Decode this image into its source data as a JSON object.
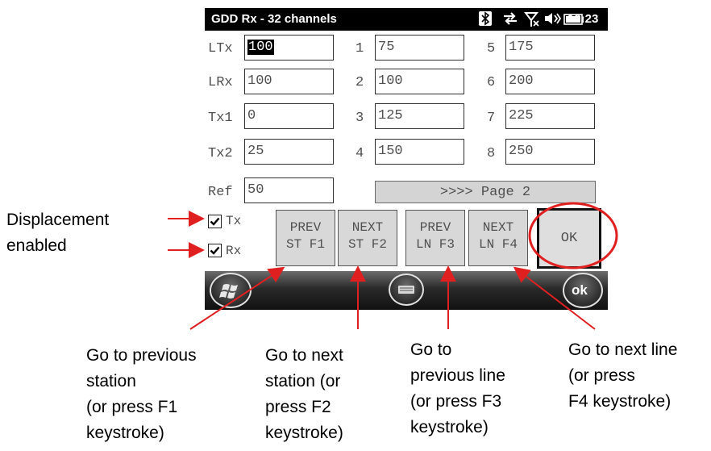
{
  "titlebar": {
    "title": "GDD Rx - 32 channels",
    "time": "10:23",
    "icons": [
      "bluetooth-icon",
      "sync-icon",
      "no-signal-icon",
      "volume-icon",
      "battery-icon"
    ]
  },
  "form": {
    "left_fields": [
      {
        "label": "LTx",
        "value": "100"
      },
      {
        "label": "LRx",
        "value": "100"
      },
      {
        "label": "Tx1",
        "value": "0"
      },
      {
        "label": "Tx2",
        "value": "25"
      },
      {
        "label": "Ref",
        "value": "50"
      }
    ],
    "mid_fields": [
      {
        "label": "1",
        "value": "75"
      },
      {
        "label": "2",
        "value": "100"
      },
      {
        "label": "3",
        "value": "125"
      },
      {
        "label": "4",
        "value": "150"
      }
    ],
    "right_fields": [
      {
        "label": "5",
        "value": "175"
      },
      {
        "label": "6",
        "value": "200"
      },
      {
        "label": "7",
        "value": "225"
      },
      {
        "label": "8",
        "value": "250"
      }
    ],
    "page_button": ">>>> Page 2",
    "checkboxes": [
      {
        "label": "Tx",
        "checked": true
      },
      {
        "label": "Rx",
        "checked": true
      }
    ],
    "nav_buttons": [
      {
        "line1": "PREV",
        "line2": "ST F1"
      },
      {
        "line1": "NEXT",
        "line2": "ST F2"
      },
      {
        "line1": "PREV",
        "line2": "LN F3"
      },
      {
        "line1": "NEXT",
        "line2": "LN F4"
      }
    ],
    "ok_button": "OK"
  },
  "softkeys": {
    "start_icon": "windows-start-icon",
    "keyboard_icon": "keyboard-icon",
    "ok": "ok"
  },
  "annotations": {
    "displacement": [
      "Displacement",
      "enabled"
    ],
    "prev_station": [
      "Go to previous",
      "station",
      "(or press F1",
      "keystroke)"
    ],
    "next_station": [
      "Go to next",
      "station (or",
      "press F2",
      "keystroke)"
    ],
    "prev_line": [
      "Go to",
      "previous line",
      "(or press F3",
      "keystroke)"
    ],
    "next_line": [
      "Go to next line",
      "(or press",
      "F4 keystroke)"
    ],
    "arrow_color": "#e02020",
    "highlight_color": "#e02020"
  }
}
